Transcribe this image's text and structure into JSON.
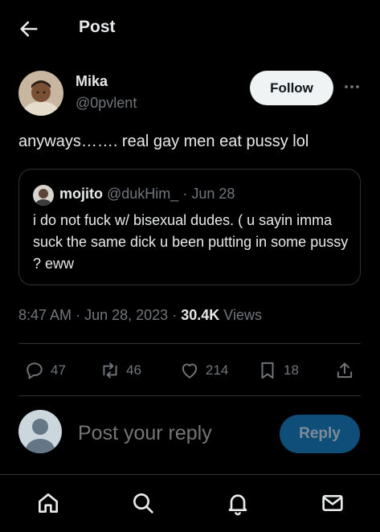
{
  "header": {
    "title": "Post",
    "back_icon": "arrow-left-icon"
  },
  "author": {
    "name": "Mika",
    "handle": "@0pvlent",
    "follow_label": "Follow"
  },
  "post": {
    "text": "anyways……. real gay men eat pussy lol"
  },
  "quote": {
    "name": "mojito",
    "handle": "@dukHim_",
    "separator": "·",
    "date": "Jun 28",
    "text": "i do not fuck w/ bisexual dudes. ( u sayin imma suck the same dick u been putting in some pussy ? eww"
  },
  "meta": {
    "time": "8:47 AM",
    "separator": "·",
    "date": "Jun 28, 2023",
    "views_count": "30.4K",
    "views_label": "Views"
  },
  "actions": {
    "replies": "47",
    "reposts": "46",
    "likes": "214",
    "bookmarks": "18"
  },
  "reply_composer": {
    "placeholder": "Post your reply",
    "button_label": "Reply"
  },
  "colors": {
    "background": "#000000",
    "text_primary": "#e7e9ea",
    "text_secondary": "#71767b",
    "border": "#2f3336",
    "reply_button": "#0f4e79"
  },
  "nav": {
    "items": [
      "home-icon",
      "search-icon",
      "notifications-icon",
      "messages-icon"
    ]
  }
}
